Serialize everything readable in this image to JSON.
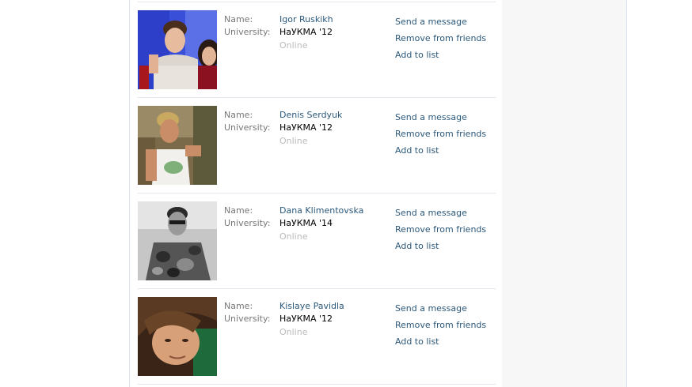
{
  "labels": {
    "name": "Name:",
    "university": "University:"
  },
  "friends": [
    {
      "name": "Igor Ruskikh",
      "university": "НаУКМА '12",
      "status": "Online"
    },
    {
      "name": "Denis Serdyuk",
      "university": "НаУКМА '12",
      "status": "Online"
    },
    {
      "name": "Dana Klimentovska",
      "university": "НаУКМА '14",
      "status": "Online"
    },
    {
      "name": "Kislaye Pavidla",
      "university": "НаУКМА '12",
      "status": "Online"
    }
  ],
  "actions": {
    "send_message": "Send a message",
    "remove_friend": "Remove from friends",
    "add_to_list": "Add to list"
  }
}
